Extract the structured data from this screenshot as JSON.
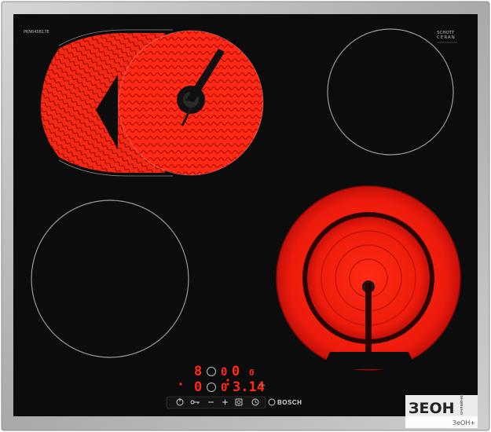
{
  "hob": {
    "model_code": "PKN645B17E",
    "schott_line1": "SCHOTT",
    "schott_line2": "CERAN",
    "brand": "BOSCH",
    "accent_color": "#ff2a1a",
    "glass_color": "#0c0c0c",
    "frame_color": "#b9b9b9",
    "zones": [
      {
        "name": "front-left",
        "state": "off"
      },
      {
        "name": "rear-left-extended",
        "state": "on"
      },
      {
        "name": "rear-right",
        "state": "off"
      },
      {
        "name": "front-right-dual",
        "state": "on"
      }
    ]
  },
  "display": {
    "row1": {
      "zone_a": "8",
      "sep1": "0",
      "zone_b": "0",
      "sep2": "0"
    },
    "row2": {
      "zone_a": "0",
      "sep1": "0",
      "timer": "3.14"
    }
  },
  "controls": [
    "power-icon",
    "key-icon",
    "minus-icon",
    "plus-icon",
    "zone-select-icon",
    "timer-icon"
  ],
  "watermark": {
    "line1": "ЗЕОН",
    "line2": "онлайнер",
    "line3": "ЗеОН+"
  }
}
